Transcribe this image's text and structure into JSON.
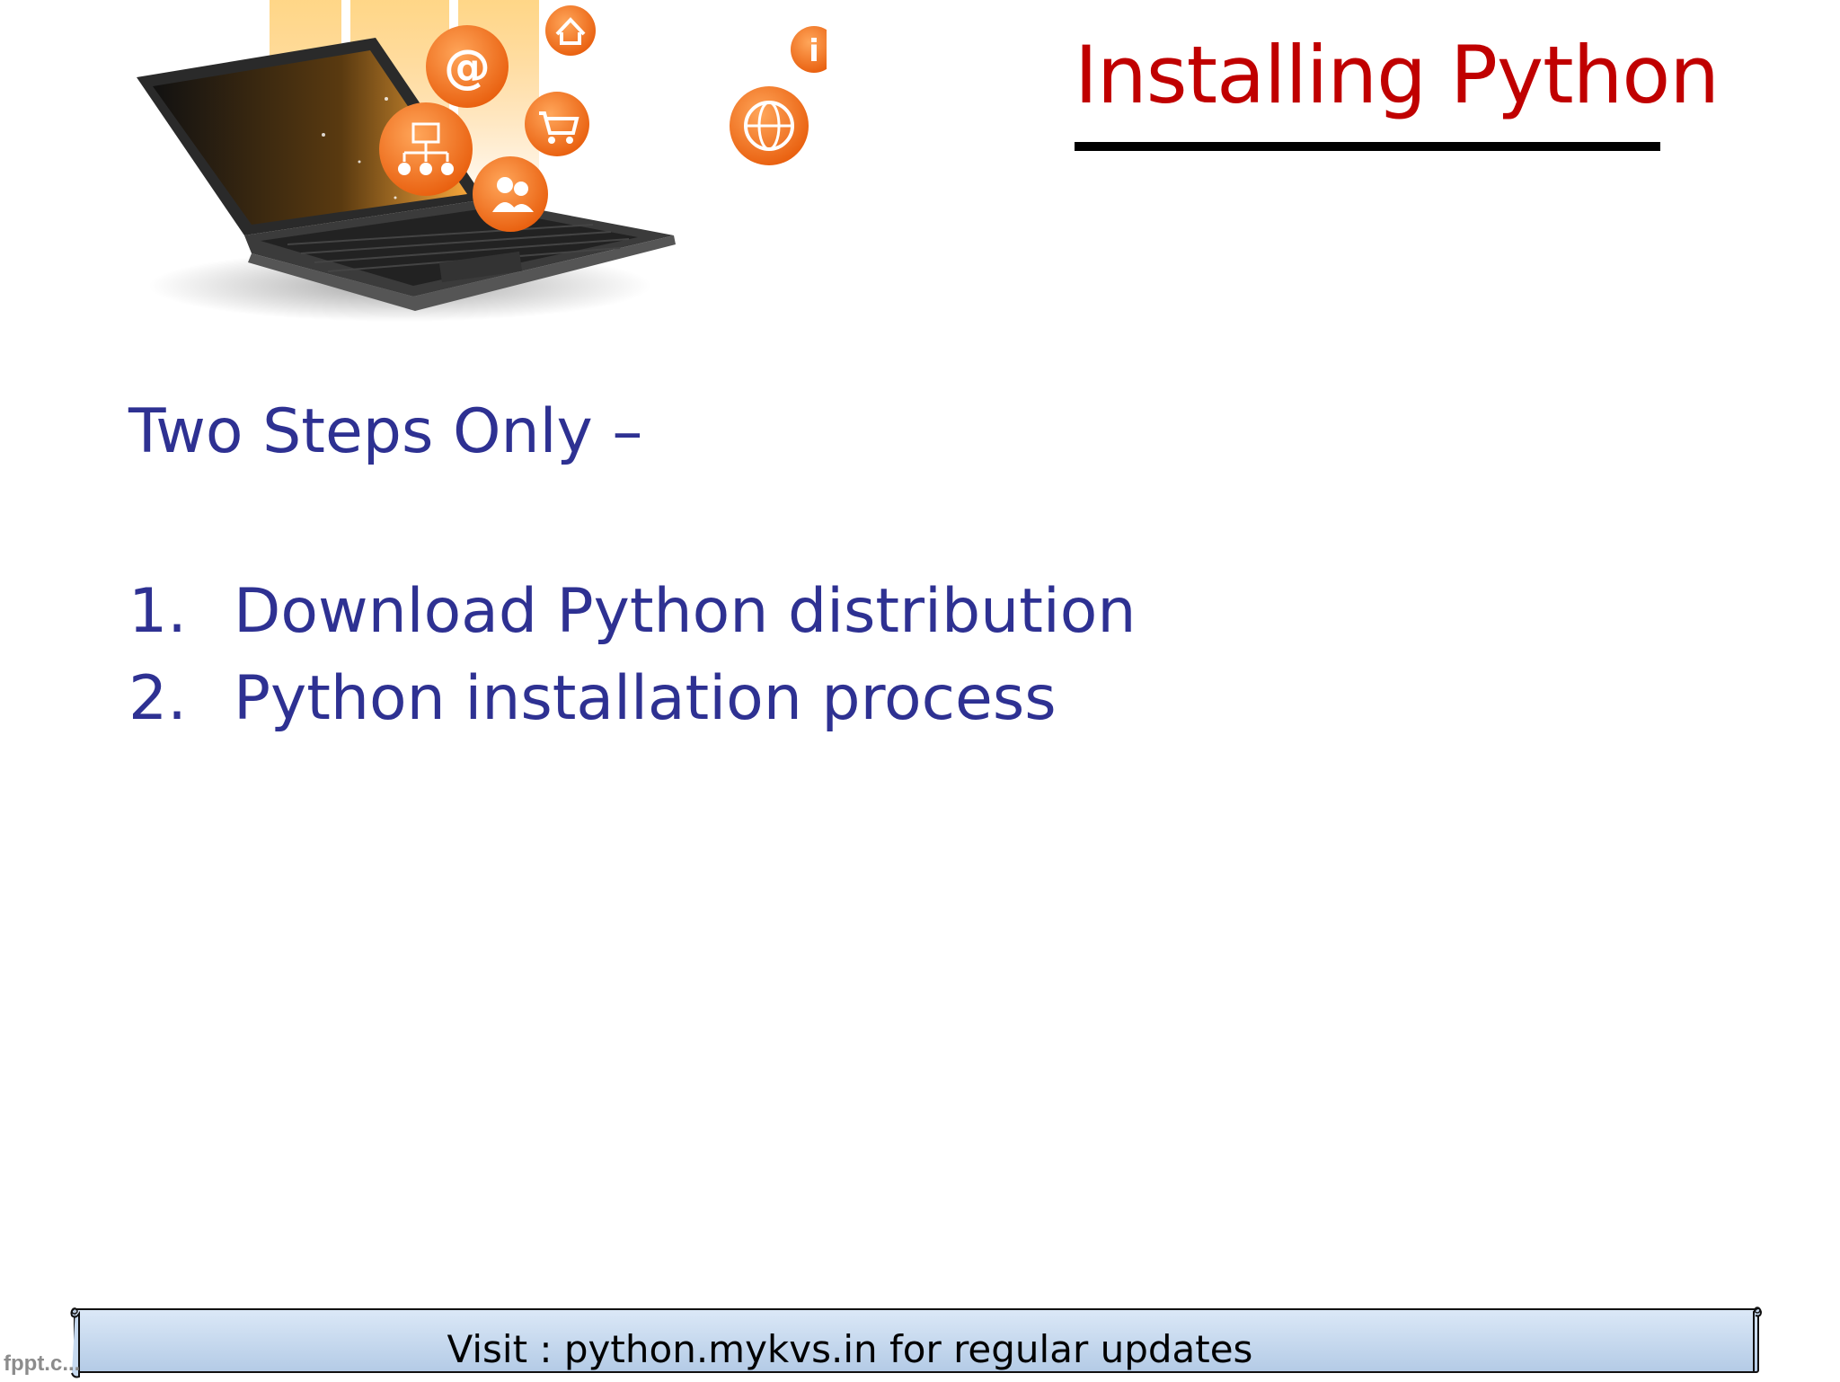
{
  "slide": {
    "title": "Installing Python",
    "lead": "Two Steps Only –",
    "steps": [
      {
        "number": "1.",
        "text": "Download Python distribution"
      },
      {
        "number": "2.",
        "text": "Python installation process"
      }
    ],
    "footer": "Visit : python.mykvs.in for regular updates",
    "watermark": "fppt.c..."
  },
  "illustration": {
    "subject": "laptop with floating web icons",
    "icons": [
      "home-icon",
      "at-sign-icon",
      "info-icon",
      "sitemap-icon",
      "shopping-cart-icon",
      "globe-icon",
      "users-icon"
    ]
  },
  "colors": {
    "title": "#c00000",
    "body_text": "#2e3192",
    "icon_orange": "#f26a1b",
    "banner_fill": "#c6d9ef"
  }
}
